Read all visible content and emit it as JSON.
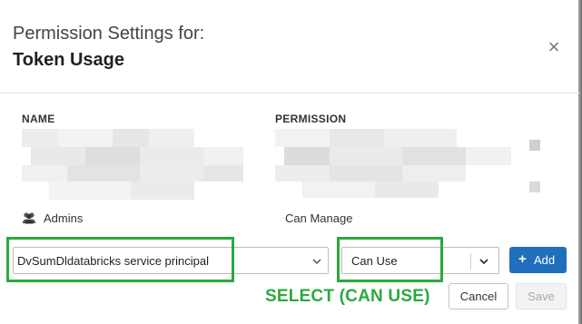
{
  "dialog": {
    "title_prefix": "Permission Settings for:",
    "title_object": "Token Usage",
    "close_label": "×"
  },
  "table": {
    "columns": [
      "NAME",
      "PERMISSION"
    ],
    "rows": [
      {
        "principal": "Admins",
        "permission": "Can Manage",
        "icon": "users-icon"
      }
    ]
  },
  "add_row": {
    "principal_value": "DvSumDldatabricks service principal",
    "permission_value": "Can Use",
    "add_label": "Add"
  },
  "annotation": {
    "text": "SELECT (CAN USE)",
    "color": "#2aaa3e"
  },
  "footer": {
    "cancel_label": "Cancel",
    "save_label": "Save"
  },
  "colors": {
    "primary": "#1f6fbd",
    "highlight": "#2aaa3e"
  }
}
